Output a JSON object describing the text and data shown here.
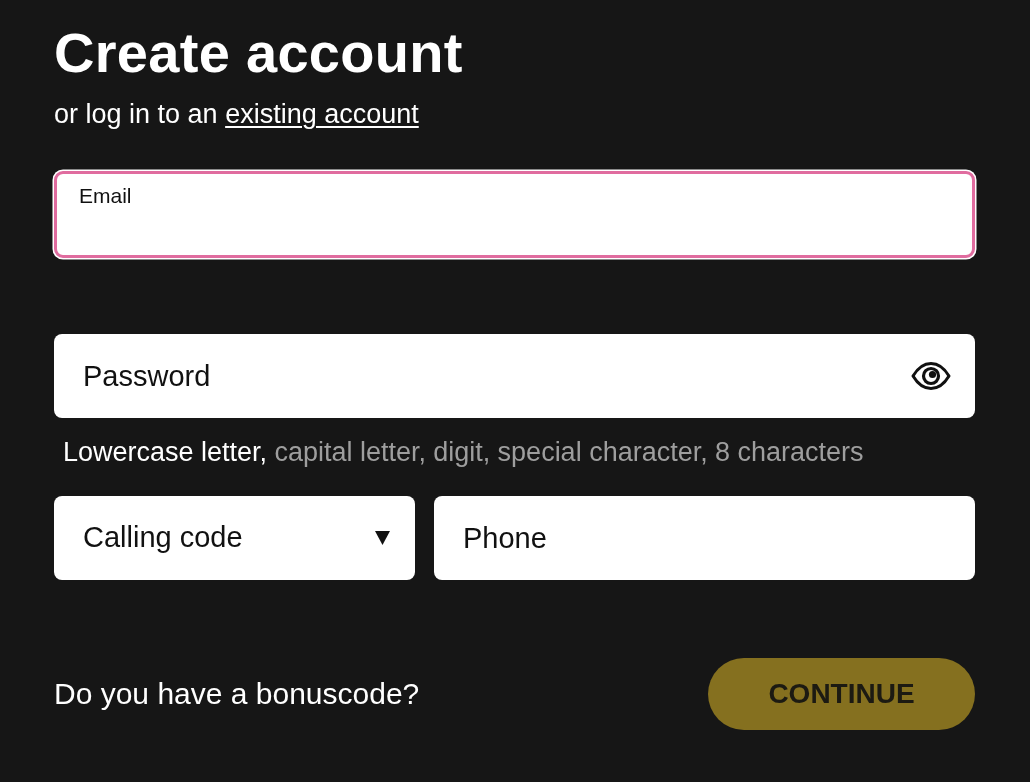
{
  "heading": {
    "title": "Create account",
    "subtitle": "or log in to an",
    "link": "existing account"
  },
  "email": {
    "label": "Email",
    "focused": true
  },
  "password": {
    "placeholder": "Password",
    "focused": false,
    "requirements": [
      {
        "text": "Lowercase letter,",
        "met": true
      },
      {
        "text": "capital letter,",
        "met": false
      },
      {
        "text": "digit,",
        "met": false
      },
      {
        "text": "special character,",
        "met": false
      },
      {
        "text": "8 characters",
        "met": false
      }
    ]
  },
  "calling_code": {
    "label": "Calling code",
    "focused": false
  },
  "phone": {
    "placeholder": "Phone",
    "focused": false
  },
  "bonuscode": {
    "text": "Do you have a bonuscode?"
  },
  "continue_button": {
    "label": "CONTINUE",
    "disabled": true
  }
}
